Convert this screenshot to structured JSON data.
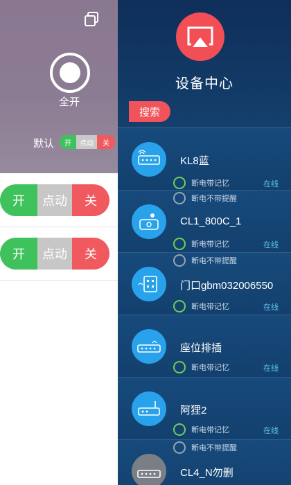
{
  "left_panel": {
    "all_on_label": "全开",
    "default_label": "默认",
    "mini_toggle": {
      "on": "开",
      "jog": "点动",
      "off": "关"
    },
    "rows": [
      {
        "on": "开",
        "jog": "点动",
        "off": "关"
      },
      {
        "on": "开",
        "jog": "点动",
        "off": "关"
      }
    ]
  },
  "drawer": {
    "title": "设备中心",
    "search_label": "搜索",
    "devices": [
      {
        "name": "KL8蓝",
        "icon": "power-strip-icon",
        "memory_tag": "断电带记忆",
        "reminder_tag": "断电不带提醒",
        "status": "在线"
      },
      {
        "name": "CL1_800C_1",
        "icon": "camera-module-icon",
        "memory_tag": "断电带记忆",
        "reminder_tag": "断电不带提醒",
        "status": "在线"
      },
      {
        "name": "门口gbm032006550",
        "icon": "wifi-socket-icon",
        "memory_tag": "断电带记忆",
        "status": "在线"
      },
      {
        "name": "座位排插",
        "icon": "power-strip-icon",
        "memory_tag": "断电带记忆",
        "status": "在线"
      },
      {
        "name": "阿狸2",
        "icon": "router-icon",
        "memory_tag": "断电带记忆",
        "reminder_tag": "断电不带提醒",
        "status": "在线"
      },
      {
        "name": "CL4_N勿删",
        "icon": "power-strip-icon"
      }
    ]
  },
  "colors": {
    "on_green": "#3fc25b",
    "jog_gray": "#c7c7c7",
    "off_red": "#f05a5f",
    "drawer_blue": "#14426e",
    "accent_red": "#f24e55",
    "icon_blue": "#29a2ec",
    "online_cyan": "#5fc6e8"
  }
}
